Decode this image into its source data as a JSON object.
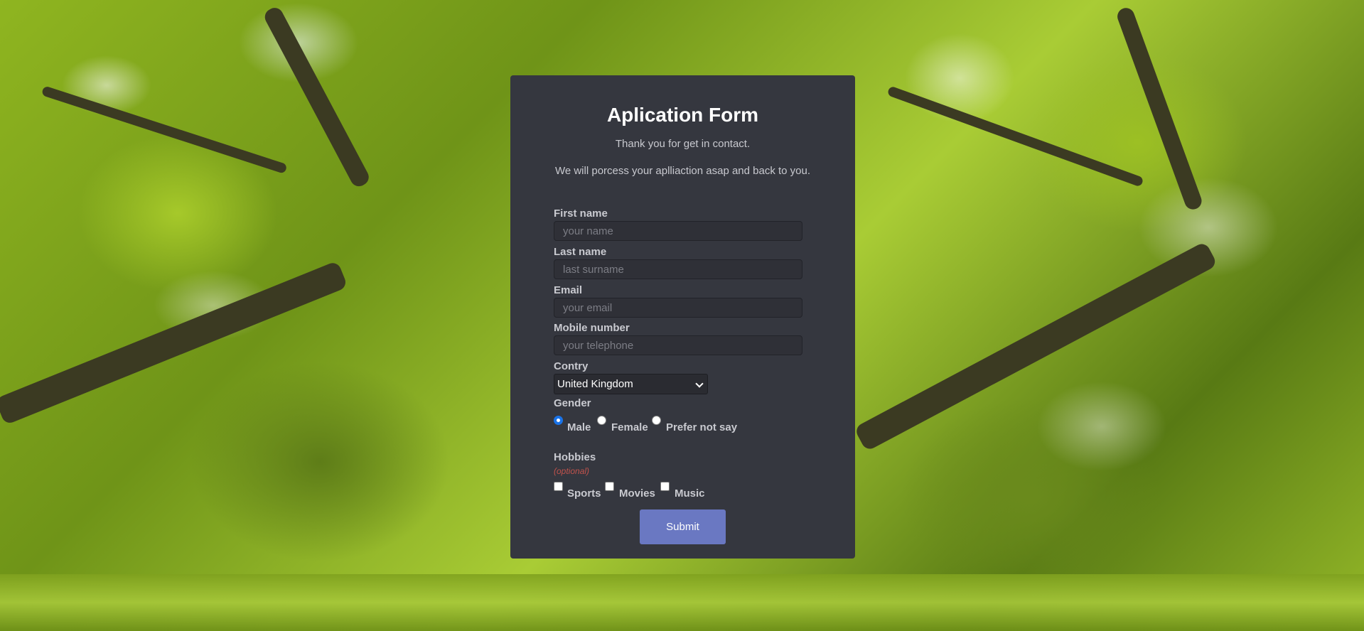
{
  "form": {
    "title": "Aplication Form",
    "subtitle1": "Thank you for get in contact.",
    "subtitle2": "We will porcess your aplliaction asap and back to you.",
    "first_name": {
      "label": "First name",
      "placeholder": "your name",
      "value": ""
    },
    "last_name": {
      "label": "Last name",
      "placeholder": "last surname",
      "value": ""
    },
    "email": {
      "label": "Email",
      "placeholder": "your email",
      "value": ""
    },
    "mobile": {
      "label": "Mobile number",
      "placeholder": "your telephone",
      "value": ""
    },
    "country": {
      "label": "Contry",
      "selected": "United Kingdom"
    },
    "gender": {
      "label": "Gender",
      "options": [
        {
          "label": "Male",
          "checked": true
        },
        {
          "label": "Female",
          "checked": false
        },
        {
          "label": "Prefer not say",
          "checked": false
        }
      ]
    },
    "hobbies": {
      "label": "Hobbies",
      "note": "(optional)",
      "options": [
        {
          "label": "Sports",
          "checked": false
        },
        {
          "label": "Movies",
          "checked": false
        },
        {
          "label": "Music",
          "checked": false
        }
      ]
    },
    "submit_label": "Submit"
  },
  "colors": {
    "card_bg": "#35373f",
    "accent": "#6a78c2",
    "optional_note": "#c0524c",
    "radio_selected": "#1a73e8"
  }
}
